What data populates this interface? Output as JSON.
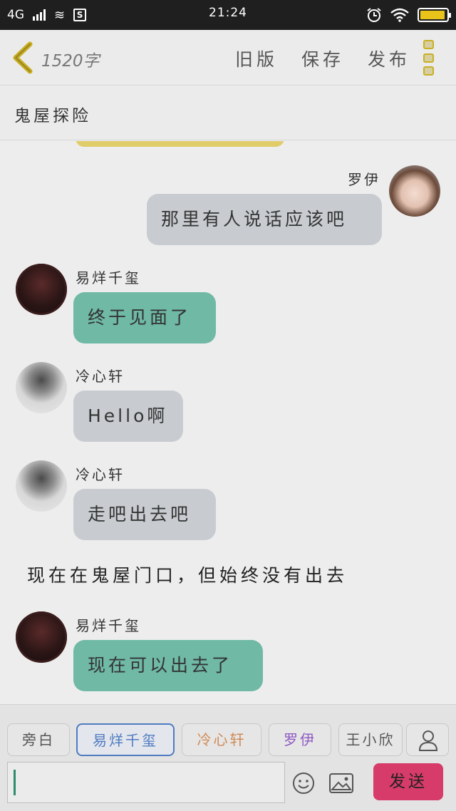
{
  "status_bar": {
    "network": "4G",
    "time": "21:24",
    "battery_percent": 95,
    "battery_color": "#e8c41a"
  },
  "header": {
    "word_count": "1520字",
    "actions": [
      "旧版",
      "保存",
      "发布"
    ]
  },
  "story": {
    "title": "鬼屋探险"
  },
  "messages": [
    {
      "speaker": "罗伊",
      "text": "那里有人说话应该吧"
    },
    {
      "speaker": "易烊千玺",
      "text": "终于见面了"
    },
    {
      "speaker": "冷心轩",
      "text": "Hello啊"
    },
    {
      "speaker": "冷心轩",
      "text": "走吧出去吧"
    },
    {
      "narration": "现在在鬼屋门口，但始终没有出去"
    },
    {
      "speaker": "易烊千玺",
      "text": "现在可以出去了"
    }
  ],
  "characters": [
    "旁白",
    "易烊千玺",
    "冷心轩",
    "罗伊",
    "王小欣"
  ],
  "selected_character": "易烊千玺",
  "input": {
    "value": ""
  },
  "send_label": "发送",
  "colors": {
    "accent_yellow": "#d9c12a",
    "teal_bubble": "#6fb9a5",
    "gray_bubble": "#c8ccd0",
    "send_button": "#d63b6a",
    "active_chip": "#4f7bc2"
  }
}
